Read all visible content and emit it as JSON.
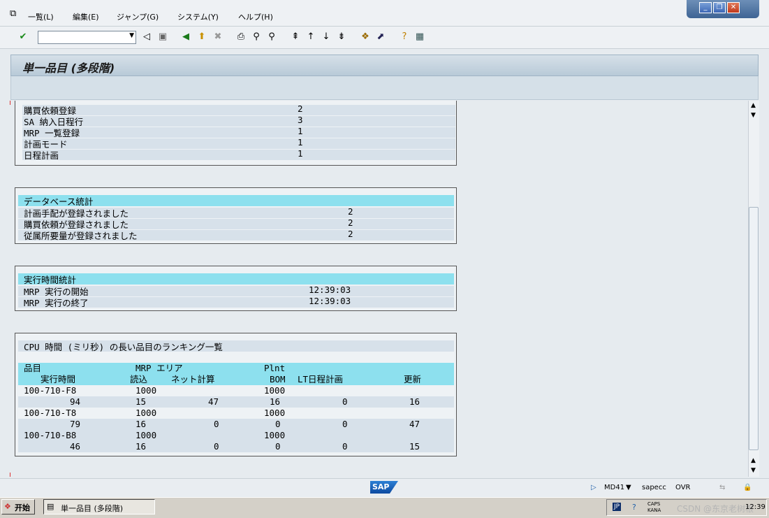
{
  "menu": [
    "一覧(L)",
    "編集(E)",
    "ジャンプ(G)",
    "システム(Y)",
    "ヘルプ(H)"
  ],
  "window_controls": {
    "minimize": "_",
    "restore": "❐",
    "close": "✕"
  },
  "toolbar": {
    "command_field_value": ""
  },
  "title": "単一品目 (多段階)",
  "top_section": {
    "rows": [
      {
        "label": "購買依頼登録",
        "value": "2"
      },
      {
        "label": "SA 納入日程行",
        "value": "3"
      },
      {
        "label": "MRP 一覧登録",
        "value": "1"
      },
      {
        "label": "計画モード",
        "value": "1"
      },
      {
        "label": "日程計画",
        "value": "1"
      }
    ]
  },
  "db_stats": {
    "header": "データベース統計",
    "rows": [
      {
        "label": "計画手配が登録されました",
        "value": "2"
      },
      {
        "label": "購買依頼が登録されました",
        "value": "2"
      },
      {
        "label": "従属所要量が登録されました",
        "value": "2"
      }
    ]
  },
  "runtime_stats": {
    "header": "実行時間統計",
    "rows": [
      {
        "label": "MRP 実行の開始",
        "value": "12:39:03"
      },
      {
        "label": "MRP 実行の終了",
        "value": "12:39:03"
      }
    ]
  },
  "cpu_ranking": {
    "header": "CPU 時間 (ミリ秒) の長い品目のランキング一覧",
    "col_header_1": {
      "item": "品目",
      "mrp_area": "MRP エリア",
      "plnt": "Plnt"
    },
    "col_header_2": {
      "runtime": "実行時間",
      "read": "読込",
      "net_calc": "ネット計算",
      "bom": "BOM",
      "lt_sched": "LT日程計画",
      "update": "更新"
    },
    "items": [
      {
        "material": "100-710-F8",
        "mrp_area": "1000",
        "plnt": "1000",
        "runtime": "94",
        "read": "15",
        "net_calc": "47",
        "bom": "16",
        "lt_sched": "0",
        "update": "16"
      },
      {
        "material": "100-710-T8",
        "mrp_area": "1000",
        "plnt": "1000",
        "runtime": "79",
        "read": "16",
        "net_calc": "0",
        "bom": "0",
        "lt_sched": "0",
        "update": "47"
      },
      {
        "material": "100-710-B8",
        "mrp_area": "1000",
        "plnt": "1000",
        "runtime": "46",
        "read": "16",
        "net_calc": "0",
        "bom": "0",
        "lt_sched": "0",
        "update": "15"
      }
    ]
  },
  "status_bar": {
    "sap_logo": "SAP",
    "transaction": "MD41",
    "server": "sapecc",
    "mode": "OVR"
  },
  "taskbar": {
    "start": "开始",
    "task_item": "単一品目 (多段階)",
    "lang": "JP",
    "ime": "CAPS KANA",
    "clock": "12:39",
    "watermark": "CSDN @东京老树根"
  }
}
